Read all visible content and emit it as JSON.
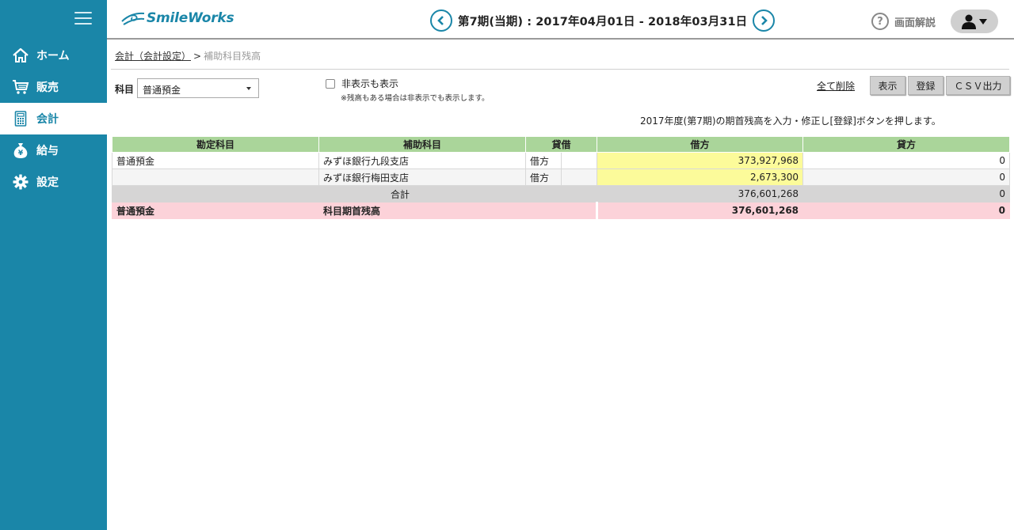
{
  "brand": {
    "name": "SmileWorks"
  },
  "header": {
    "period_text": "第7期(当期) : 2017年04月01日 - 2018年03月31日",
    "help_label": "画面解説"
  },
  "sidebar": {
    "items": [
      {
        "label": "ホーム",
        "icon": "home-icon",
        "active": false
      },
      {
        "label": "販売",
        "icon": "cart-icon",
        "active": false
      },
      {
        "label": "会計",
        "icon": "calculator-icon",
        "active": true
      },
      {
        "label": "給与",
        "icon": "money-bag-icon",
        "active": false
      },
      {
        "label": "設定",
        "icon": "gear-icon",
        "active": false
      }
    ]
  },
  "breadcrumb": {
    "parent": "会計（会計設定）",
    "separator": ">",
    "current": "補助科目残高"
  },
  "filter": {
    "account_label": "科目",
    "account_value": "普通預金",
    "hidden_checkbox_label": "非表示も表示",
    "hidden_checkbox_note": "※残高もある場合は非表示でも表示します。"
  },
  "actions": {
    "delete_all": "全て削除",
    "show": "表示",
    "register": "登録",
    "csv": "ＣＳＶ出力"
  },
  "instruction": "2017年度(第7期)の期首残高を入力・修正し[登録]ボタンを押します。",
  "table": {
    "headers": [
      "勘定科目",
      "補助科目",
      "貸借",
      "借方",
      "貸方"
    ],
    "rows": [
      {
        "account": "普通預金",
        "sub": "みずほ銀行九段支店",
        "side": "借方",
        "debit": "373,927,968",
        "credit": "0"
      },
      {
        "account": "",
        "sub": "みずほ銀行梅田支店",
        "side": "借方",
        "debit": "2,673,300",
        "credit": "0"
      }
    ],
    "total": {
      "label": "合計",
      "debit": "376,601,268",
      "credit": "0"
    },
    "opening": {
      "account": "普通預金",
      "label": "科目期首残高",
      "debit": "376,601,268",
      "credit": "0"
    }
  },
  "colors": {
    "sidebar": "#1a86a8",
    "header_row": "#aad59a",
    "debit_highlight": "#fcfb9a",
    "opening_row": "#fcd2d9",
    "total_row": "#d6d5d5"
  }
}
